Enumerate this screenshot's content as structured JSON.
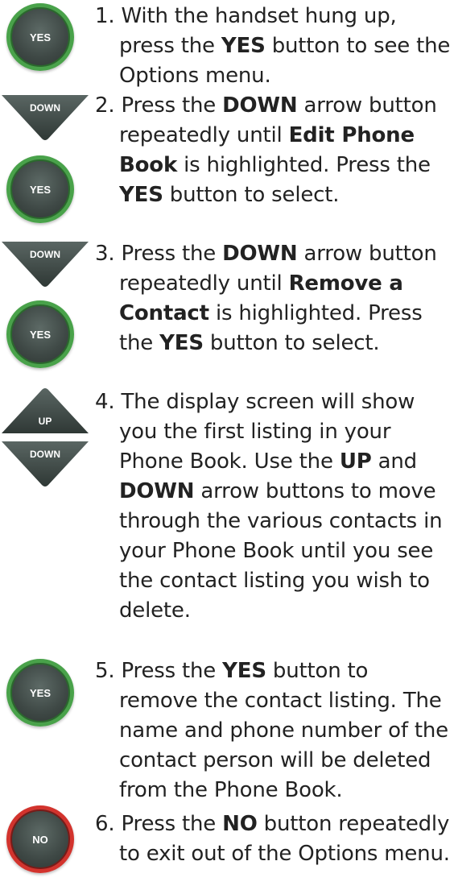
{
  "icons": {
    "yes": "YES",
    "no": "NO",
    "down": "DOWN",
    "up": "UP"
  },
  "steps": [
    {
      "num": "1.",
      "parts": [
        "With the handset hung up, press the ",
        "YES",
        " button to see the Options menu."
      ]
    },
    {
      "num": "2.",
      "parts": [
        "Press the ",
        "DOWN",
        " arrow button repeatedly until ",
        "Edit Phone Book",
        " is highlighted. Press the ",
        "YES",
        " button to select."
      ]
    },
    {
      "num": "3.",
      "parts": [
        "Press the ",
        "DOWN",
        " arrow button repeatedly until ",
        "Remove a Contact",
        " is highlighted. Press the ",
        "YES",
        " button to select."
      ]
    },
    {
      "num": "4.",
      "parts": [
        "The display screen will show you the first listing in your Phone Book. Use the ",
        "UP",
        " and ",
        "DOWN",
        " arrow buttons to move through the various contacts in your Phone Book until you see the contact listing you wish to delete."
      ]
    },
    {
      "num": "5.",
      "parts": [
        "Press the ",
        "YES",
        " button to remove the contact listing. The name and phone number of the contact person will be deleted from the Phone Book."
      ]
    },
    {
      "num": "6.",
      "parts": [
        "Press the ",
        "NO",
        " button repeatedly to exit out of the Options menu."
      ]
    }
  ]
}
